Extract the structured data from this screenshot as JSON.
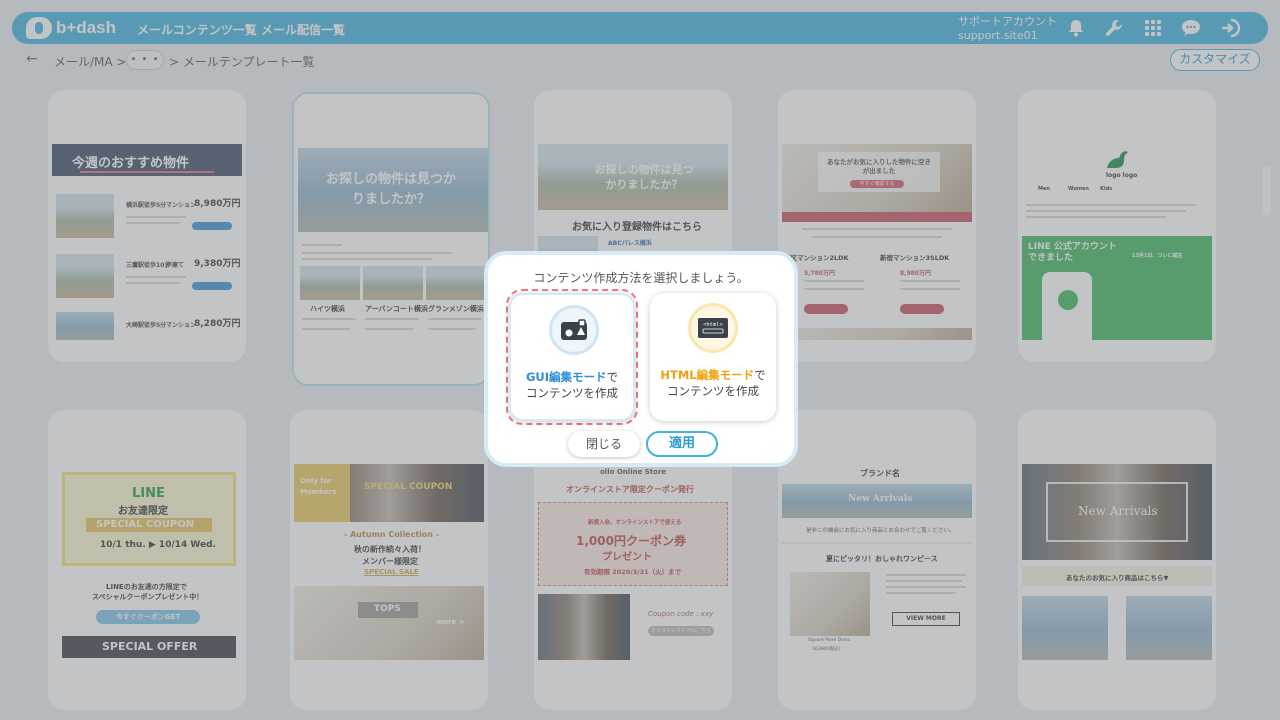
{
  "app": {
    "logo_text": "b+dash"
  },
  "header": {
    "nav": [
      "メールコンテンツ一覧",
      "メール配信一覧"
    ],
    "account_name": "サポートアカウント",
    "account_id": "support.site01",
    "icons": [
      "bell-icon",
      "wrench-icon",
      "grid-icon",
      "chat-icon",
      "logout-icon"
    ]
  },
  "breadcrumb": {
    "back_icon": "←",
    "item1": "メール/MA >",
    "more": "• • •",
    "item2": "> メールテンプレート一覧",
    "customize_label": "カスタマイズ"
  },
  "templates": [
    {
      "headline": "今週のおすすめ物件",
      "rows": [
        {
          "station": "横浜駅徒歩5分",
          "type": "マンション",
          "price": "8,980万円"
        },
        {
          "station": "三鷹駅徒歩10分",
          "type": "戸建て",
          "price": "9,380万円"
        },
        {
          "station": "大崎駅徒歩5分",
          "type": "マンション",
          "price": "8,280万円"
        }
      ]
    },
    {
      "headline": "お探しの物件は見つかりましたか？",
      "props": [
        "ハイツ横浜",
        "アーバンコート横浜",
        "グランメゾン横浜"
      ]
    },
    {
      "headline": "お探しの物件は見つかりましたか？",
      "sub": "お気に入り登録物件はこちら",
      "tag": "ABCパレス横浜"
    },
    {
      "headline": "あなたがお気に入りした物件に空きが出ました",
      "btn": "今すぐ確認する",
      "props": [
        "港区マンション2LDK",
        "新宿マンション3SLDK"
      ],
      "prices": [
        "5,780万円",
        "8,980万円"
      ]
    },
    {
      "logo": "logo logo",
      "tabs": [
        "Men",
        "Women",
        "Kids"
      ],
      "banner_title": "LINE 公式アカウントできました",
      "banner_note": "13月1日、ついに誕生"
    },
    {
      "title": "LINE",
      "subtitle": "お友達限定",
      "coupon": "SPECIAL COUPON",
      "dates": "10/1 thu. ▶ 10/14 Wed.",
      "text1": "LINEのお友達の方限定で",
      "text2": "スペシャルクーポンプレゼント中！",
      "btn": "今すぐクーポンGET",
      "footer": "SPECIAL OFFER"
    },
    {
      "side": "Only for Members",
      "title": "SPECIAL COUPON",
      "collection": "- Autumn Collection -",
      "line1": "秋の新作続々入荷！",
      "line2": "メンバー様限定",
      "sale": "SPECIAL SALE",
      "tops": "TOPS",
      "more": "more >"
    },
    {
      "header": "ollo Online Store",
      "title": "オンラインストア限定クーポン発行",
      "note": "新規入会、オンラインストアで使える",
      "coupon": "1,000円クーポン券",
      "present": "プレゼント",
      "deadline": "有効期限 2020/3/31（火）まで",
      "code": "Coupon code : xxy",
      "btn": "オンラインストアはこちら"
    },
    {
      "brand": "ブランド名",
      "banner": "New Arrivals",
      "text": "是非この機会にお気に入り商品とお合わせでご覧ください。",
      "section": "夏にピッタリ！おしゃれワンピース",
      "item": "Square Pane Dress",
      "price": "16,980(税込)",
      "btn": "VIEW MORE"
    },
    {
      "banner": "New Arrivals",
      "bar": "あなたのお気に入り商品はこちら▼"
    }
  ],
  "modal": {
    "title": "コンテンツ作成方法を選択しましょう。",
    "gui": {
      "highlight": "GUI編集モード",
      "suffix": "で",
      "line2": "コンテンツを作成",
      "icon": "gui-editor-icon"
    },
    "html": {
      "highlight": "HTML編集モード",
      "suffix": "で",
      "line2": "コンテンツを作成",
      "icon": "html-code-icon",
      "icon_text": "<html>"
    },
    "close_label": "閉じる",
    "apply_label": "適用"
  },
  "colors": {
    "brand": "#3fb3dc",
    "gui_accent": "#2c8fd8",
    "html_accent": "#f0a20a",
    "selection_outline": "#f07a86",
    "line_green": "#06c755"
  }
}
